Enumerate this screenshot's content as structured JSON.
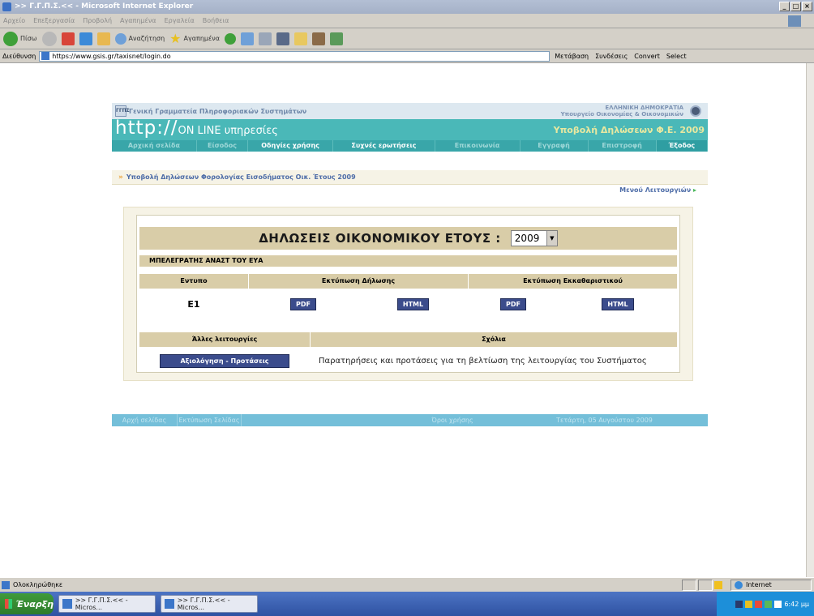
{
  "window": {
    "title": ">> Γ.Γ.Π.Σ.<< - Microsoft Internet Explorer",
    "controls": [
      "_",
      "□",
      "×"
    ]
  },
  "menu": [
    "Αρχείο",
    "Επεξεργασία",
    "Προβολή",
    "Αγαπημένα",
    "Εργαλεία",
    "Βοήθεια"
  ],
  "toolbar": {
    "back": "Πίσω",
    "search": "Αναζήτηση",
    "favorites": "Αγαπημένα"
  },
  "address": {
    "label": "Διεύθυνση",
    "url": "https://www.gsis.gr/taxisnet/login.do",
    "go": "Μετάβαση",
    "links": "Συνδέσεις",
    "convert": "Convert",
    "select": "Select"
  },
  "header": {
    "gsis": "Γενική Γραμματεία Πληροφοριακών Συστημάτων",
    "gsis_logo": "ΓΓΠΣ",
    "gov_line1": "ΕΛΛΗΝΙΚΗ ΔΗΜΟΚΡΑΤΙΑ",
    "gov_line2": "Υπουργείο Οικονομίας & Οικονομικών",
    "banner_prefix": "http://",
    "banner_online": "ON LINE υπηρεσίες",
    "banner_right": "Υποβολή Δηλώσεων Φ.Ε. 2009"
  },
  "nav": [
    "Αρχική σελίδα",
    "Είσοδος",
    "Οδηγίες χρήσης",
    "Συχνές ερωτήσεις",
    "Επικοινωνία",
    "Εγγραφή",
    "Επιστροφή",
    "Έξοδος"
  ],
  "breadcrumb": "Υποβολή Δηλώσεων Φορολογίας Εισοδήματος Οικ. Έτους 2009",
  "functions_link": "Μενού Λειτουργιών",
  "form": {
    "year_label": "ΔΗΛΩΣΕΙΣ ΟΙΚΟΝΟΜΙΚΟΥ ΕΤΟΥΣ :",
    "year_value": "2009",
    "taxpayer": "ΜΠΕΛΕΓΡΑΤΗΣ ΑΝΑΣΤ ΤΟΥ ΕΥΑ",
    "col_form": "Εντυπο",
    "col_print_decl": "Εκτύπωση Δήλωσης",
    "col_print_clear": "Εκτύπωση Εκκαθαριστικού",
    "row_form": "Ε1",
    "pdf": "PDF",
    "html": "HTML",
    "other_label": "Άλλες λειτουργίες",
    "comments_label": "Σχόλια",
    "eval_button": "Αξιολόγηση - Προτάσεις",
    "comment_text": "Παρατηρήσεις και προτάσεις για τη βελτίωση της λειτουργίας του Συστήματος"
  },
  "footer": {
    "home": "Αρχή σελίδας",
    "print": "Εκτύπωση Σελίδας",
    "user": "Όροι χρήσης",
    "date": "Τετάρτη, 05 Αυγούστου 2009"
  },
  "status": {
    "text": "Ολοκληρώθηκε",
    "zone": "Internet"
  },
  "taskbar": {
    "start": "Έναρξη",
    "tasks": [
      ">> Γ.Γ.Π.Σ.<< - Micros...",
      ">> Γ.Γ.Π.Σ.<< - Micros..."
    ],
    "clock": "6:42 μμ"
  },
  "colors": {
    "banner": "#4ab8b8",
    "nav": "#39a6a9",
    "table_header": "#d9cda8",
    "button": "#3b4c8c",
    "footer": "#74bfd9"
  }
}
